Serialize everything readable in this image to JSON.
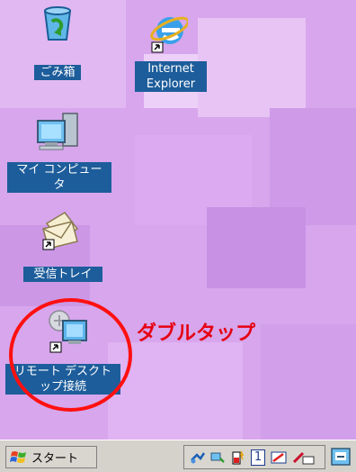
{
  "desktop_icons": [
    {
      "label": "ごみ箱"
    },
    {
      "label": "Internet\nExplorer"
    },
    {
      "label": "マイ コンピュー\nタ"
    },
    {
      "label": "受信トレイ"
    },
    {
      "label": "リモート デスクト\nップ接続"
    }
  ],
  "annotation": {
    "text": "ダブルタップ"
  },
  "taskbar": {
    "start_label": "スタート",
    "tray_number": "1"
  },
  "colors": {
    "desktop_bg": "#d7a6ec",
    "label_bg": "#1d5d9b",
    "annotation": "#e60012",
    "taskbar": "#d5d2cb"
  }
}
